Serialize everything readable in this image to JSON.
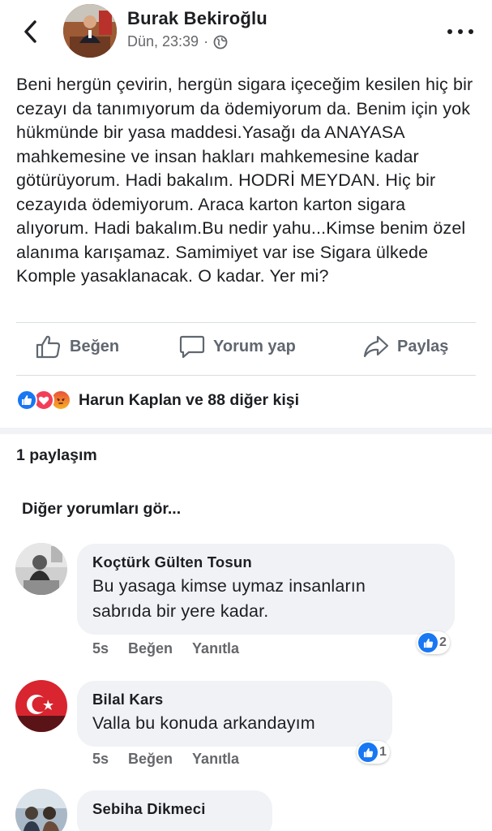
{
  "header": {
    "back_icon": "chevron-left-icon",
    "author_name": "Burak Bekiroğlu",
    "timestamp": "Dün, 23:39",
    "separator": "·",
    "privacy_icon": "globe-icon",
    "more_icon": "more-dots-icon"
  },
  "post": {
    "text": "Beni hergün çevirin, hergün sigara içeceğim kesilen hiç bir cezayı da tanımıyorum da ödemiyorum da. Benim için yok hükmünde bir yasa maddesi.Yasağı da ANAYASA mahkemesine ve insan hakları mahkemesine kadar götürüyorum. Hadi bakalım. HODRİ MEYDAN. Hiç bir cezayıda ödemiyorum. Araca karton karton sigara alıyorum. Hadi bakalım.Bu nedir yahu...Kimse benim özel alanıma karışamaz. Samimiyet var ise Sigara ülkede Komple yasaklanacak. O kadar. Yer mi?"
  },
  "actions": {
    "like_label": "Beğen",
    "comment_label": "Yorum yap",
    "share_label": "Paylaş"
  },
  "reactions": {
    "types": [
      "like",
      "love",
      "angry"
    ],
    "summary": "Harun Kaplan ve 88 diğer kişi"
  },
  "shares_count": "1 paylaşım",
  "more_comments": "Diğer yorumları gör...",
  "comments": [
    {
      "author": "Koçtürk Gülten Tosun",
      "text_lines": [
        "Bu yasaga kimse uymaz insanların",
        "sabrıda bir yere kadar."
      ],
      "time": "5s",
      "like_label": "Beğen",
      "reply_label": "Yanıtla",
      "like_count": "2"
    },
    {
      "author": "Bilal Kars",
      "text_lines": [
        "Valla bu konuda arkandayım"
      ],
      "time": "5s",
      "like_label": "Beğen",
      "reply_label": "Yanıtla",
      "like_count": "1"
    },
    {
      "author": "Sebiha Dikmeci"
    }
  ],
  "colors": {
    "accent_blue": "#1877f2",
    "love_red": "#f33e58",
    "angry_orange": "#f7714c",
    "text_primary": "#1c1e21",
    "text_secondary": "#65676b",
    "bubble_gray": "#f0f2f5"
  }
}
